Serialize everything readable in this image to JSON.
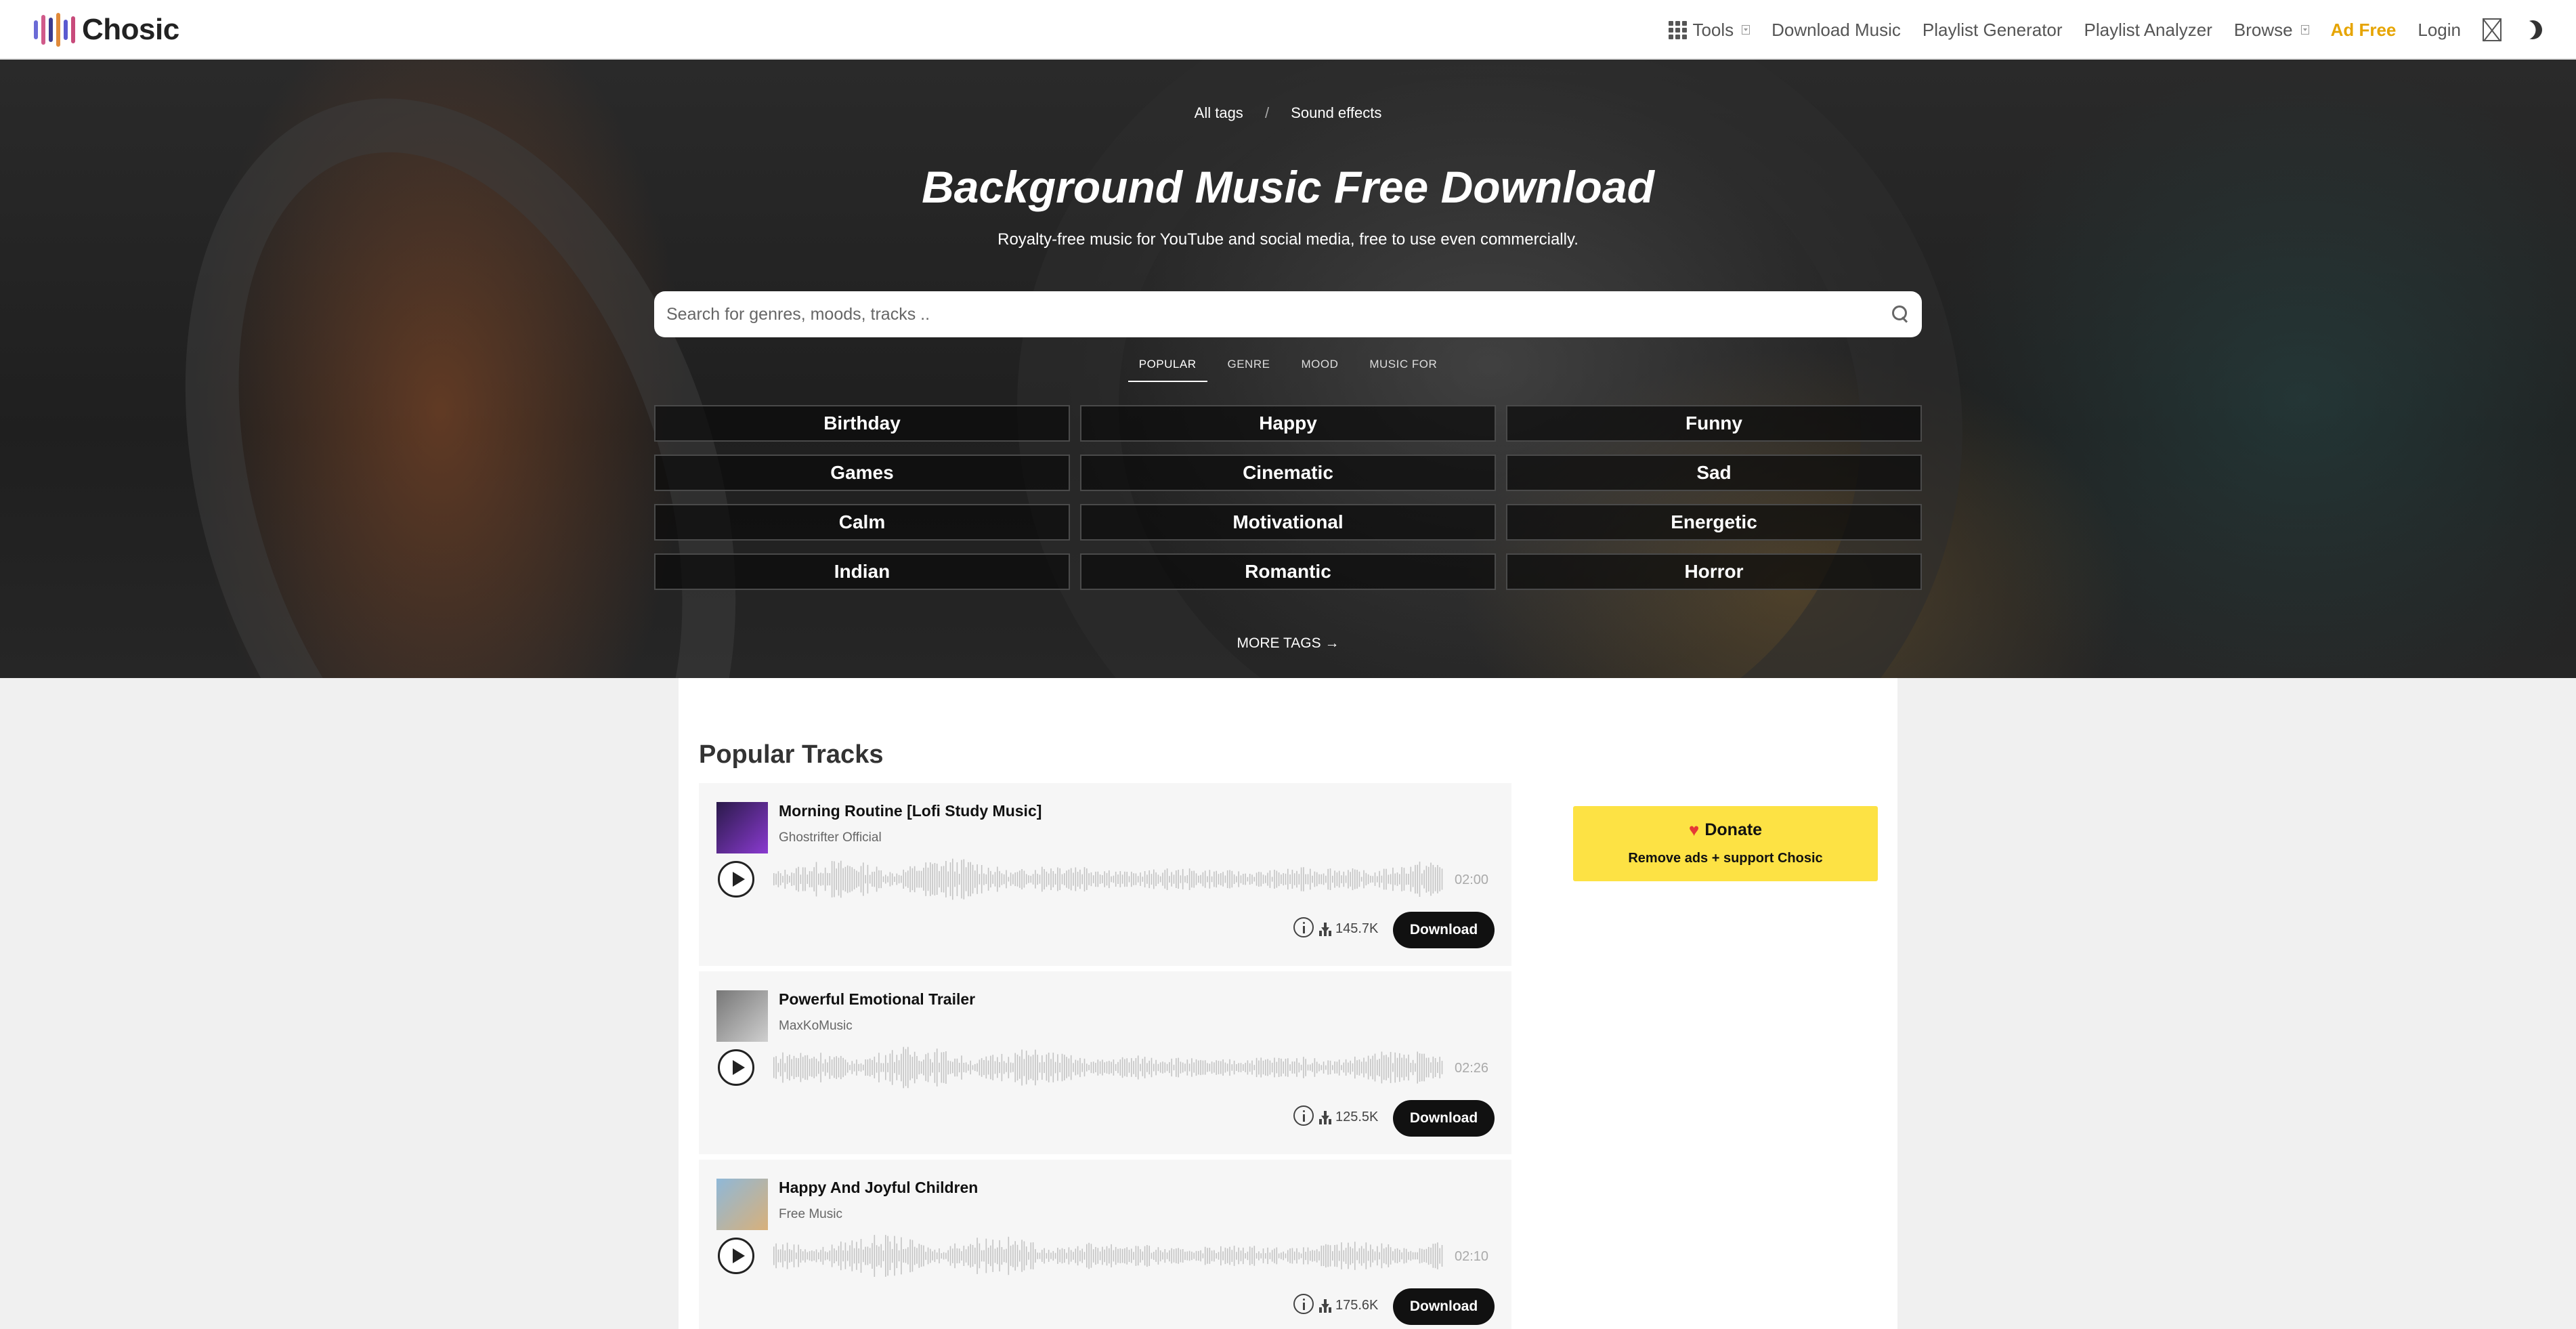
{
  "brand": {
    "name": "Chosic",
    "logo_colors": [
      "#6b6bd6",
      "#d05a8a",
      "#3b3b8f",
      "#e08a3a",
      "#5a5ad0",
      "#c84b7b"
    ]
  },
  "nav": {
    "tools": "Tools",
    "download_music": "Download Music",
    "playlist_generator": "Playlist Generator",
    "playlist_analyzer": "Playlist Analyzer",
    "browse": "Browse",
    "ad_free": "Ad Free",
    "login": "Login"
  },
  "hero": {
    "breadcrumb": {
      "all_tags": "All tags",
      "separator": "/",
      "sound_effects": "Sound effects"
    },
    "title": "Background Music Free Download",
    "subtitle": "Royalty-free music for YouTube and social media, free to use even commercially.",
    "search_placeholder": "Search for genres, moods, tracks ..",
    "tabs": [
      "POPULAR",
      "GENRE",
      "MOOD",
      "MUSIC FOR"
    ],
    "active_tab": "POPULAR",
    "tags": [
      "Birthday",
      "Happy",
      "Funny",
      "Games",
      "Cinematic",
      "Sad",
      "Calm",
      "Motivational",
      "Energetic",
      "Indian",
      "Romantic",
      "Horror"
    ],
    "more_tags": "MORE TAGS →"
  },
  "popular": {
    "title": "Popular Tracks",
    "tracks": [
      {
        "title": "Morning Routine [Lofi Study Music]",
        "artist": "Ghostrifter Official",
        "duration": "02:00",
        "downloads": "145.7K",
        "download_label": "Download",
        "thumb_colors": [
          "#2a1a4a",
          "#8a3ad0"
        ]
      },
      {
        "title": "Powerful Emotional Trailer",
        "artist": "MaxKoMusic",
        "duration": "02:26",
        "downloads": "125.5K",
        "download_label": "Download",
        "thumb_colors": [
          "#777777",
          "#cfcfcf"
        ]
      },
      {
        "title": "Happy And Joyful Children",
        "artist": "Free Music",
        "duration": "02:10",
        "downloads": "175.6K",
        "download_label": "Download",
        "thumb_colors": [
          "#8fb8d8",
          "#d8b07a"
        ]
      }
    ]
  },
  "donate": {
    "label": "Donate",
    "sub": "Remove ads + support Chosic"
  }
}
